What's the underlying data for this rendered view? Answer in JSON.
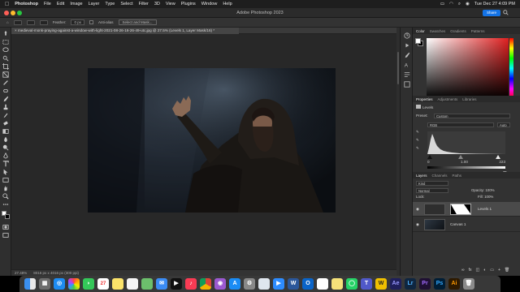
{
  "menubar": {
    "app_name": "Photoshop",
    "items": [
      "File",
      "Edit",
      "Image",
      "Layer",
      "Type",
      "Select",
      "Filter",
      "3D",
      "View",
      "Plugins",
      "Window",
      "Help"
    ],
    "clock": "Tue Dec 27  4:09 PM"
  },
  "titlebar": {
    "title": "Adobe Photoshop 2023",
    "share_label": "Share"
  },
  "options": {
    "feather_label": "Feather:",
    "feather_value": "0 px",
    "antialias_label": "Anti-alias",
    "select_mask_label": "Select and Mask..."
  },
  "document": {
    "tab_title": "medieval-monk-praying-against-a-window-with-light-2021-08-26-16-26-49-utc.jpg @ 27.5% (Levels 1, Layer Mask/16) *",
    "zoom": "27.48%",
    "dimensions": "8016 px x 4016 px (300 ppi)"
  },
  "color_panel": {
    "tabs": [
      "Color",
      "Swatches",
      "Gradients",
      "Patterns"
    ],
    "foreground": "#ffffff",
    "background": "#000000"
  },
  "properties_panel": {
    "tabs": [
      "Properties",
      "Adjustments",
      "Libraries"
    ],
    "adjustment_name": "Levels",
    "preset_label": "Preset:",
    "preset_value": "Custom",
    "channel_value": "RGB",
    "auto_label": "Auto",
    "input_values": [
      "0",
      "1.00",
      "223"
    ]
  },
  "layers_panel": {
    "tabs": [
      "Layers",
      "Channels",
      "Paths"
    ],
    "filter_label": "Kind",
    "blend_mode": "Normal",
    "opacity_label": "Opacity:",
    "opacity_value": "100%",
    "lock_label": "Lock:",
    "fill_label": "Fill:",
    "fill_value": "100%",
    "layers": [
      {
        "name": "Levels 1",
        "type": "adjustment"
      },
      {
        "name": "Canvas 1",
        "type": "image"
      }
    ]
  },
  "dock": {
    "apps": [
      "finder",
      "launchpad",
      "safari",
      "photos",
      "messages",
      "calendar",
      "notes",
      "reminders",
      "maps",
      "mail",
      "tv",
      "music",
      "chrome",
      "podcasts",
      "app-store",
      "system-settings",
      "preview",
      "zoom",
      "word",
      "outlook",
      "slack",
      "stickies",
      "whatsapp",
      "teams",
      "word-2",
      "after-effects",
      "lightroom",
      "premiere",
      "photoshop",
      "illustrator",
      "trash"
    ]
  }
}
